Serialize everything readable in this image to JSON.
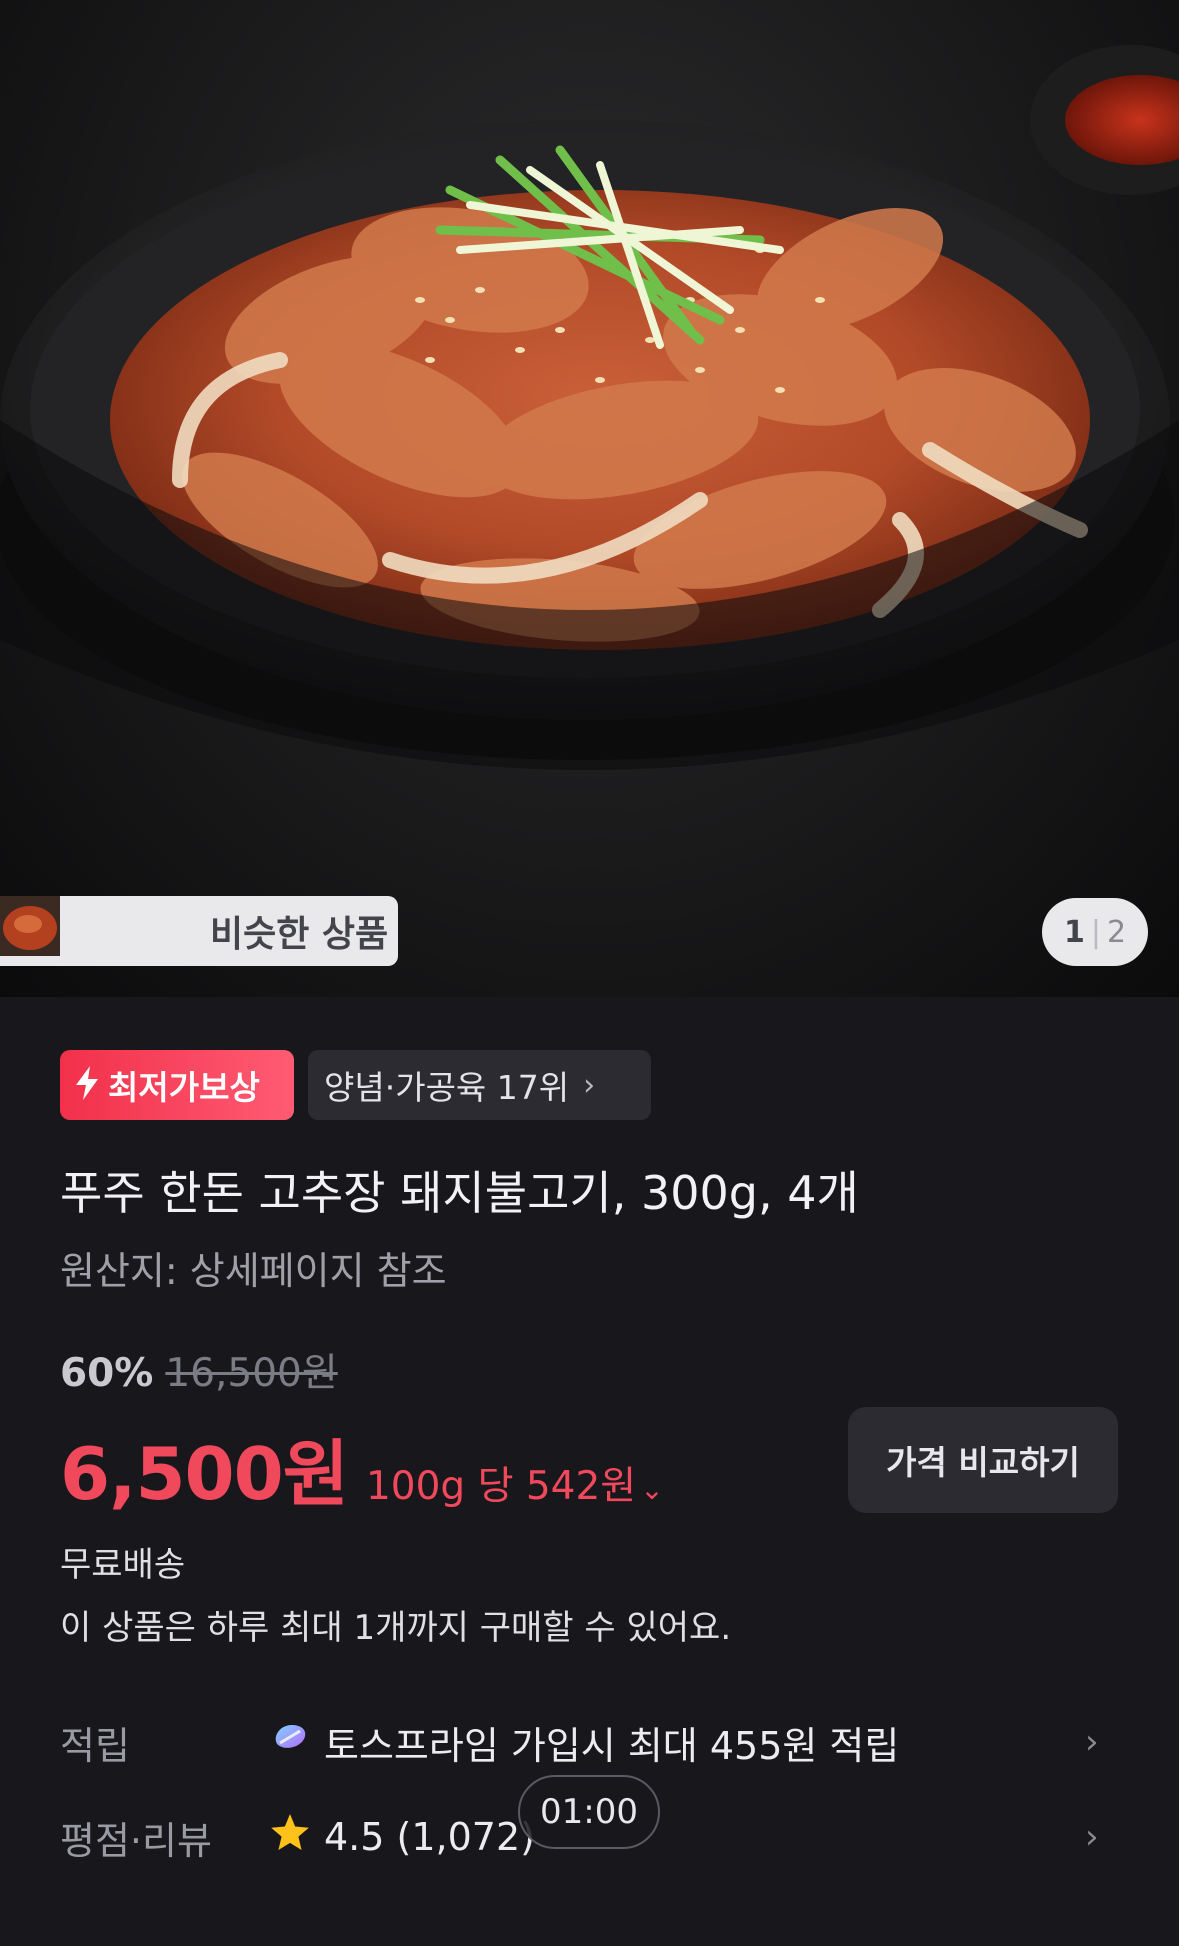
{
  "gallery": {
    "similar_products_label": "비슷한 상품",
    "page_current": "1",
    "page_total": "2"
  },
  "badges": {
    "lowest_price_label": "최저가보상",
    "category_rank_label": "양념·가공육 17위"
  },
  "product": {
    "title": "푸주 한돈 고추장 돼지불고기, 300g, 4개",
    "origin": "원산지: 상세페이지 참조",
    "discount_rate": "60%",
    "original_price": "16,500원",
    "price": "6,500원",
    "unit_price": "100g 당 542원",
    "compare_button": "가격 비교하기",
    "shipping": "무료배송",
    "purchase_limit": "이 상품은 하루 최대 1개까지 구매할 수 있어요."
  },
  "details": {
    "points_key": "적립",
    "points_value": "토스프라임 가입시 최대 455원 적립",
    "rating_key": "평점·리뷰",
    "rating_value": "4.5 (1,072)"
  },
  "overlay": {
    "timer": "01:00"
  },
  "colors": {
    "accent_red": "#f0495c",
    "background": "#17171c",
    "chip_bg": "#2b2b31"
  }
}
